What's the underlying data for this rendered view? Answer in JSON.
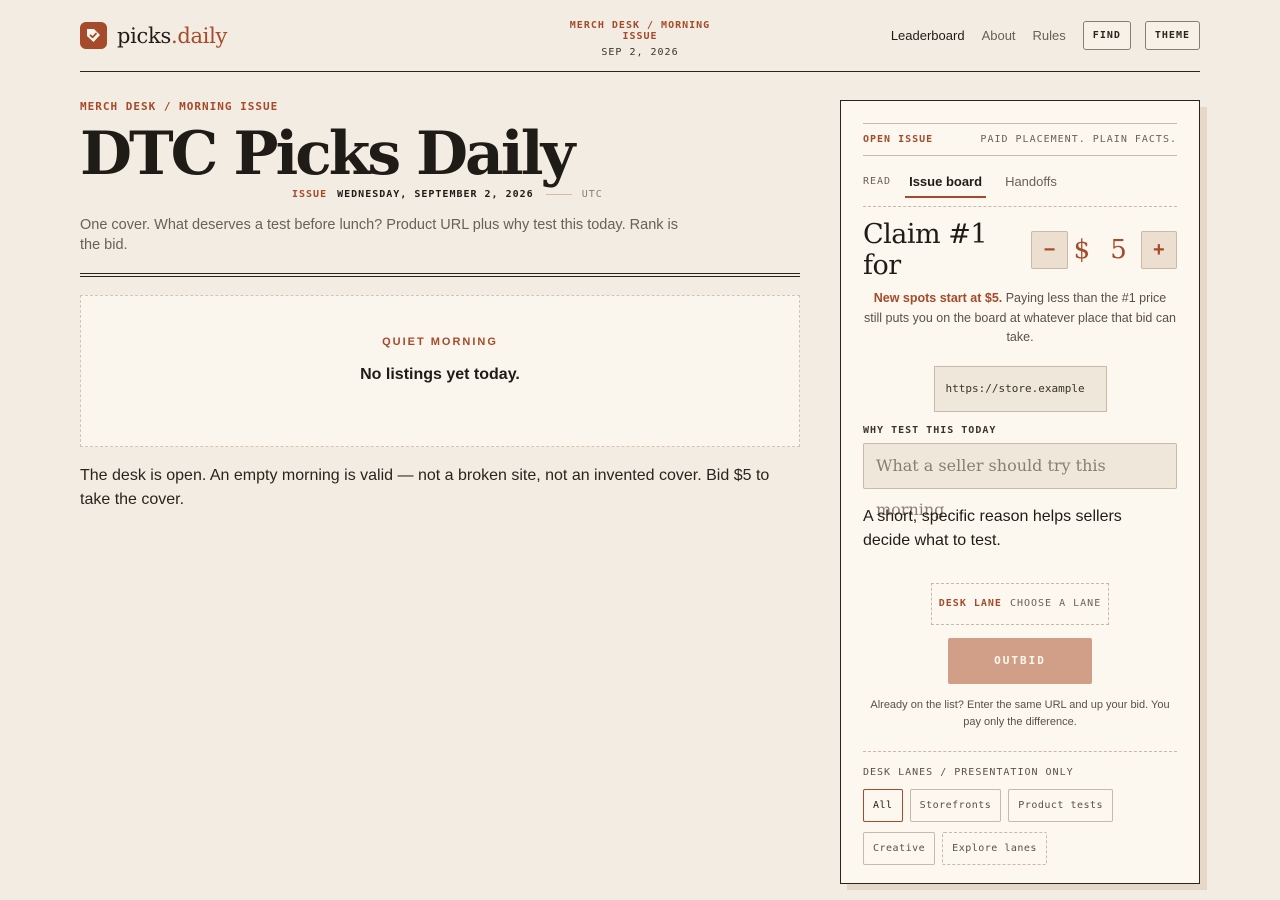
{
  "header": {
    "logo": {
      "name": "picks",
      "suffix": ".daily"
    },
    "kicker": "MERCH DESK / MORNING ISSUE",
    "date": "SEP 2, 2026",
    "nav": [
      "Leaderboard",
      "About",
      "Rules"
    ],
    "find_label": "FIND",
    "theme_label": "THEME"
  },
  "main": {
    "kicker": "MERCH DESK / MORNING ISSUE",
    "title": "DTC Picks Daily",
    "issue_label": "ISSUE",
    "issue_date": "WEDNESDAY, SEPTEMBER 2, 2026",
    "timezone": "UTC",
    "dek": "One cover. What deserves a test before lunch? Product URL plus why test this today. Rank is the bid.",
    "empty_kicker": "QUIET MORNING",
    "empty_message": "No listings yet today.",
    "note": "The desk is open. An empty morning is valid — not a broken site, not an invented cover. Bid $5 to take the cover."
  },
  "panel": {
    "open_label": "OPEN ISSUE",
    "open_tagline": "PAID PLACEMENT. PLAIN FACTS.",
    "read_label": "READ",
    "tabs": [
      "Issue board",
      "Handoffs"
    ],
    "claim_label": "Claim #1 for",
    "currency": "$",
    "price": "5",
    "minus": "−",
    "plus": "+",
    "help_strong": "New spots start at $5.",
    "help_rest": " Paying less than the #1 price still puts you on the board at whatever place that bid can take.",
    "url_value": "https://store.example",
    "why_label": "WHY TEST THIS TODAY",
    "why_placeholder": "What a seller should try this morning",
    "reason": "A short, specific reason helps sellers decide what to test.",
    "lane_label": "DESK LANE",
    "lane_value": "CHOOSE A LANE",
    "outbid_label": "OUTBID",
    "small_help": "Already on the list? Enter the same URL and up your bid. You pay only the difference.",
    "lanes_head": "DESK LANES / PRESENTATION ONLY",
    "lanes": [
      "All",
      "Storefronts",
      "Product tests",
      "Creative"
    ],
    "explore_label": "Explore lanes"
  },
  "colors": {
    "accent": "#a54a2a",
    "background": "#f3ece2",
    "panel": "#fcf8ef",
    "button": "#d19e88"
  }
}
